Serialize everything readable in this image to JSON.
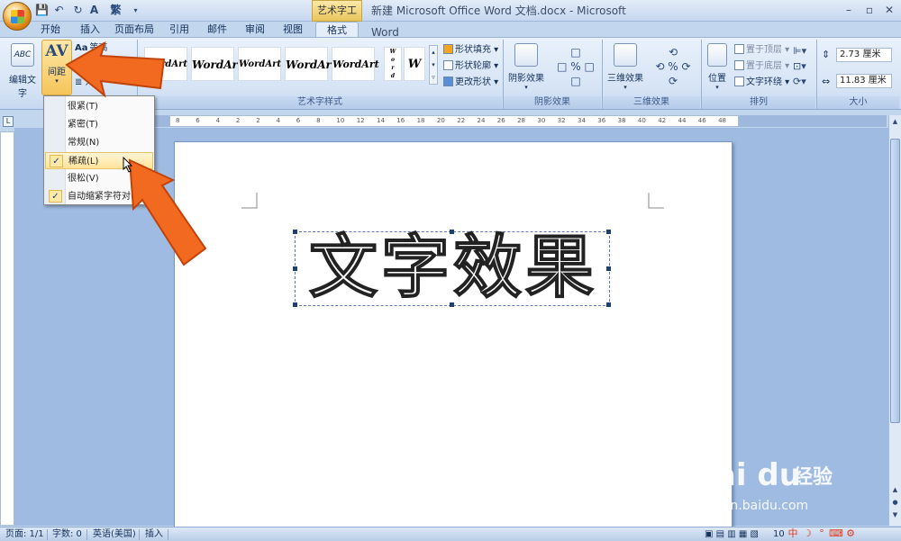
{
  "titlebar": {
    "context_tab_label": "艺术字工具",
    "window_title": "新建 Microsoft Office Word 文档.docx - Microsoft Word",
    "qat_items": [
      "save-icon",
      "undo-icon",
      "redo-icon",
      "spellcheck-icon",
      "traditional-chinese-icon"
    ],
    "qat_trad_label": "繁"
  },
  "tabs": [
    {
      "label": "开始",
      "active": false
    },
    {
      "label": "插入",
      "active": false
    },
    {
      "label": "页面布局",
      "active": false
    },
    {
      "label": "引用",
      "active": false
    },
    {
      "label": "邮件",
      "active": false
    },
    {
      "label": "审阅",
      "active": false
    },
    {
      "label": "视图",
      "active": false
    },
    {
      "label": "格式",
      "active": true
    }
  ],
  "ribbon": {
    "edit_text_label": "编辑文字",
    "spacing_label": "间距",
    "spacing_icon_text": "AV",
    "same_height_label": "等高",
    "same_height_icon_text": "Aa",
    "b_label": "b",
    "align_label": "对",
    "wordart_style_labels": [
      "WordArt",
      "WordArt",
      "WordArt",
      "WordArt",
      "WordArt",
      "W"
    ],
    "wordart_styles_group": "艺术字样式",
    "shape_fill": "形状填充",
    "shape_outline": "形状轮廓",
    "change_shape": "更改形状",
    "shadow_effects": "阴影效果",
    "shadow_group": "阴影效果",
    "three_d_effects": "三维效果",
    "three_d_group": "三维效果",
    "position": "位置",
    "bring_to_front": "置于顶层",
    "send_to_back": "置于底层",
    "text_wrapping": "文字环绕",
    "arrange_group": "排列",
    "height_value": "2.73 厘米",
    "width_value": "11.83 厘米",
    "size_group": "大小"
  },
  "spacing_menu": {
    "items": [
      {
        "label": "很紧(T)",
        "checked": false,
        "highlighted": false
      },
      {
        "label": "紧密(T)",
        "checked": false,
        "highlighted": false
      },
      {
        "label": "常规(N)",
        "checked": false,
        "highlighted": false
      },
      {
        "label": "稀疏(L)",
        "checked": true,
        "highlighted": true
      },
      {
        "label": "很松(V)",
        "checked": false,
        "highlighted": false
      },
      {
        "label": "自动缩紧字符对(K)",
        "checked": true,
        "highlighted": false
      }
    ],
    "check_mark": "✓"
  },
  "ruler": {
    "ticks": [
      "8",
      "6",
      "4",
      "2",
      "2",
      "4",
      "6",
      "8",
      "10",
      "12",
      "14",
      "16",
      "18",
      "20",
      "22",
      "24",
      "26",
      "28",
      "30",
      "32",
      "34",
      "36",
      "38",
      "40",
      "42",
      "44",
      "46",
      "48"
    ],
    "corner_mark": "L"
  },
  "document": {
    "wordart_text": "文字效果"
  },
  "statusbar": {
    "page": "页面: 1/1",
    "word_count": "字数: 0",
    "language": "英语(美国)",
    "mode": "插入",
    "zoom": "10"
  },
  "watermark": {
    "brand": "Bai du",
    "brand_cn": "经验",
    "url": "jingyan.baidu.com"
  },
  "ime": [
    "中",
    "☽",
    "°",
    "⌨",
    "⚙"
  ]
}
